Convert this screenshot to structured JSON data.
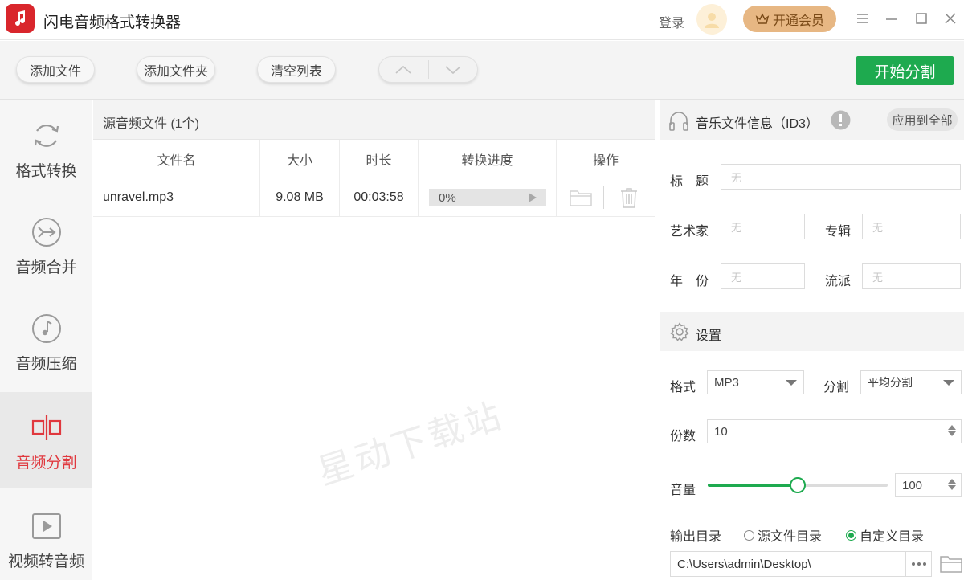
{
  "app": {
    "title": "闪电音频格式转换器"
  },
  "header": {
    "login_label": "登录",
    "vip_label": "开通会员"
  },
  "toolbar": {
    "add_file": "添加文件",
    "add_folder": "添加文件夹",
    "clear_list": "清空列表",
    "start_label": "开始分割"
  },
  "nav": {
    "items": [
      {
        "label": "格式转换",
        "icon": "refresh-icon"
      },
      {
        "label": "音频合并",
        "icon": "merge-icon"
      },
      {
        "label": "音频压缩",
        "icon": "music-note-icon"
      },
      {
        "label": "音频分割",
        "icon": "split-icon",
        "active": true
      },
      {
        "label": "视频转音频",
        "icon": "play-icon"
      }
    ]
  },
  "file_list": {
    "header": "源音频文件 (1个)",
    "columns": [
      "文件名",
      "大小",
      "时长",
      "转换进度",
      "操作"
    ],
    "rows": [
      {
        "name": "unravel.mp3",
        "size": "9.08 MB",
        "duration": "00:03:58",
        "progress": "0%",
        "progress_value": 0
      }
    ]
  },
  "watermark": "星动下载站",
  "id3": {
    "title": "音乐文件信息（ID3）",
    "apply_all": "应用到全部",
    "fields": {
      "title_label": "标　题",
      "artist_label": "艺术家",
      "album_label": "专辑",
      "year_label": "年　份",
      "genre_label": "流派",
      "placeholder": "无"
    }
  },
  "settings": {
    "title": "设置",
    "format_label": "格式",
    "format_value": "MP3",
    "split_label": "分割",
    "split_value": "平均分割",
    "parts_label": "份数",
    "parts_value": "10",
    "volume_label": "音量",
    "volume_value": "100",
    "volume_percent": 0.5,
    "output_label": "输出目录",
    "output_options": [
      "源文件目录",
      "自定义目录"
    ],
    "output_selected": "自定义目录",
    "output_path": "C:\\Users\\admin\\Desktop\\"
  },
  "colors": {
    "brand_red": "#d9262c",
    "accent_green": "#1eaa4f",
    "vip_gold": "#e7b783",
    "active_text": "#e0383e"
  }
}
